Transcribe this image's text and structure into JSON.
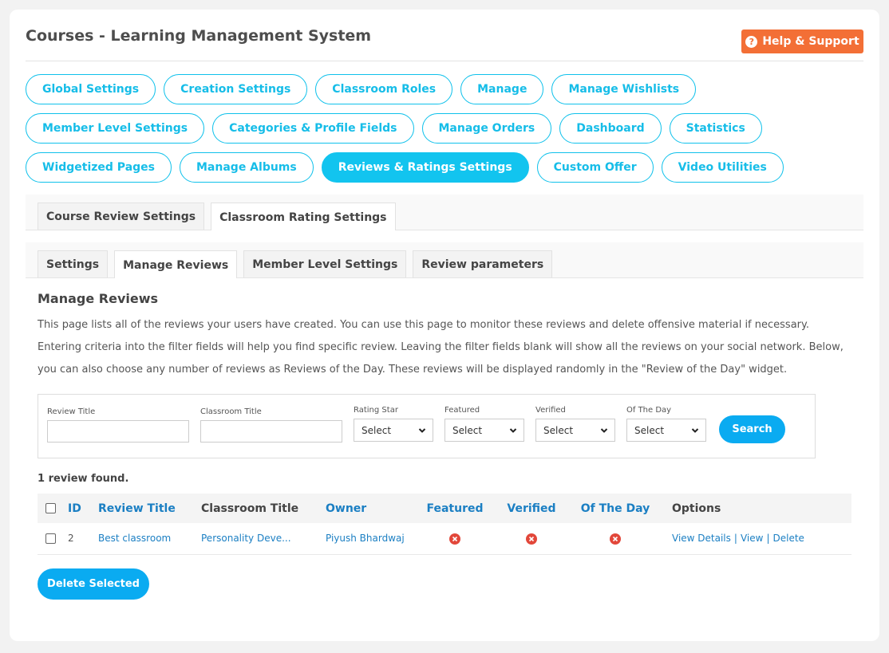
{
  "header": {
    "title": "Courses - Learning Management System",
    "help_label": "Help & Support",
    "help_icon": "question-circle-icon"
  },
  "colors": {
    "accent": "#12c4ef",
    "button_blue": "#0aabf1",
    "help_orange": "#f36f36",
    "link_blue": "#1b7fc3",
    "status_no": "#e2473a"
  },
  "nav": {
    "items": [
      {
        "label": "Global Settings",
        "active": false
      },
      {
        "label": "Creation Settings",
        "active": false
      },
      {
        "label": "Classroom Roles",
        "active": false
      },
      {
        "label": "Manage",
        "active": false
      },
      {
        "label": "Manage Wishlists",
        "active": false
      },
      {
        "label": "Member Level Settings",
        "active": false
      },
      {
        "label": "Categories & Profile Fields",
        "active": false
      },
      {
        "label": "Manage Orders",
        "active": false
      },
      {
        "label": "Dashboard",
        "active": false
      },
      {
        "label": "Statistics",
        "active": false
      },
      {
        "label": "Widgetized Pages",
        "active": false
      },
      {
        "label": "Manage Albums",
        "active": false
      },
      {
        "label": "Reviews & Ratings Settings",
        "active": true
      },
      {
        "label": "Custom Offer",
        "active": false
      },
      {
        "label": "Video Utilities",
        "active": false
      }
    ]
  },
  "tabs": {
    "top": [
      {
        "label": "Course Review Settings",
        "active": false
      },
      {
        "label": "Classroom Rating Settings",
        "active": true
      }
    ],
    "sub": [
      {
        "label": "Settings",
        "active": false
      },
      {
        "label": "Manage Reviews",
        "active": true
      },
      {
        "label": "Member Level Settings",
        "active": false
      },
      {
        "label": "Review parameters",
        "active": false
      }
    ]
  },
  "section": {
    "title": "Manage Reviews",
    "description": "This page lists all of the reviews your users have created. You can use this page to monitor these reviews and delete offensive material if necessary. Entering criteria into the filter fields will help you find specific review. Leaving the filter fields blank will show all the reviews on your social network. Below, you can also choose any number of reviews as Reviews of the Day. These reviews will be displayed randomly in the \"Review of the Day\" widget."
  },
  "filters": {
    "review_title": {
      "label": "Review Title",
      "value": ""
    },
    "classroom_title": {
      "label": "Classroom Title",
      "value": ""
    },
    "rating_star": {
      "label": "Rating Star",
      "value": "Select"
    },
    "featured": {
      "label": "Featured",
      "value": "Select"
    },
    "verified": {
      "label": "Verified",
      "value": "Select"
    },
    "of_the_day": {
      "label": "Of The Day",
      "value": "Select"
    },
    "search_label": "Search"
  },
  "results": {
    "count_text": "1 review found.",
    "columns": [
      "ID",
      "Review Title",
      "Classroom Title",
      "Owner",
      "Featured",
      "Verified",
      "Of The Day",
      "Options"
    ],
    "rows": [
      {
        "id": "2",
        "review_title": "Best classroom",
        "classroom_title": "Personality Deve...",
        "owner": "Piyush Bhardwaj",
        "featured": "no",
        "verified": "no",
        "of_the_day": "no",
        "options": [
          "View Details",
          "View",
          "Delete"
        ]
      }
    ],
    "delete_selected_label": "Delete Selected"
  }
}
